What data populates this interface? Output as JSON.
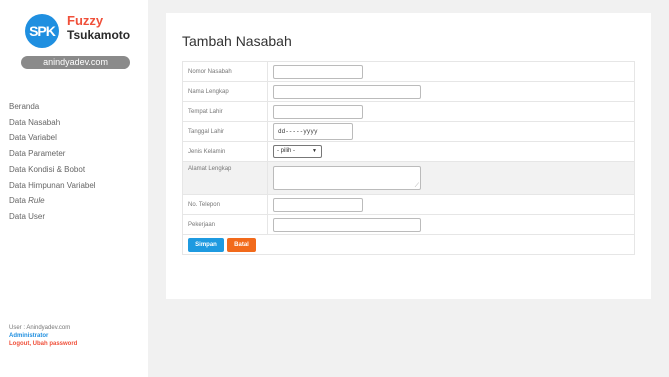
{
  "logo": {
    "circle_text": "SPK",
    "line1": "Fuzzy",
    "line2": "Tsukamoto"
  },
  "site_label": "anindyadev.com",
  "menu": [
    {
      "label": "Beranda",
      "name": "menu-beranda"
    },
    {
      "label": "Data Nasabah",
      "name": "menu-data-nasabah"
    },
    {
      "label": "Data Variabel",
      "name": "menu-data-variabel"
    },
    {
      "label": "Data Parameter",
      "name": "menu-data-parameter"
    },
    {
      "label": "Data Kondisi & Bobot",
      "name": "menu-data-kondisi-bobot"
    },
    {
      "label": "Data Himpunan Variabel",
      "name": "menu-data-himpunan-variabel"
    },
    {
      "label_prefix": "Data ",
      "label_italic": "Rule",
      "name": "menu-data-rule"
    },
    {
      "label": "Data User",
      "name": "menu-data-user"
    }
  ],
  "user": {
    "line": "User : Anindyadev.com",
    "role": "Administrator",
    "links": "Logout, Ubah password"
  },
  "page": {
    "title": "Tambah Nasabah"
  },
  "form": {
    "nomor_nasabah": {
      "label": "Nomor Nasabah",
      "value": ""
    },
    "nama_lengkap": {
      "label": "Nama Lengkap",
      "value": ""
    },
    "tempat_lahir": {
      "label": "Tempat Lahir",
      "value": ""
    },
    "tanggal_lahir": {
      "label": "Tanggal Lahir",
      "placeholder": "dd-----yyyy"
    },
    "jenis_kelamin": {
      "label": "Jenis Kelamin",
      "selected": "- pilih -"
    },
    "alamat_lengkap": {
      "label": "Alamat Lengkap",
      "value": ""
    },
    "no_telepon": {
      "label": "No. Telepon",
      "value": ""
    },
    "pekerjaan": {
      "label": "Pekerjaan",
      "value": ""
    }
  },
  "buttons": {
    "save": "Simpan",
    "cancel": "Batal"
  },
  "colors": {
    "primary": "#1e9ae0",
    "danger": "#f26a1b",
    "brand_red": "#f0503a"
  }
}
